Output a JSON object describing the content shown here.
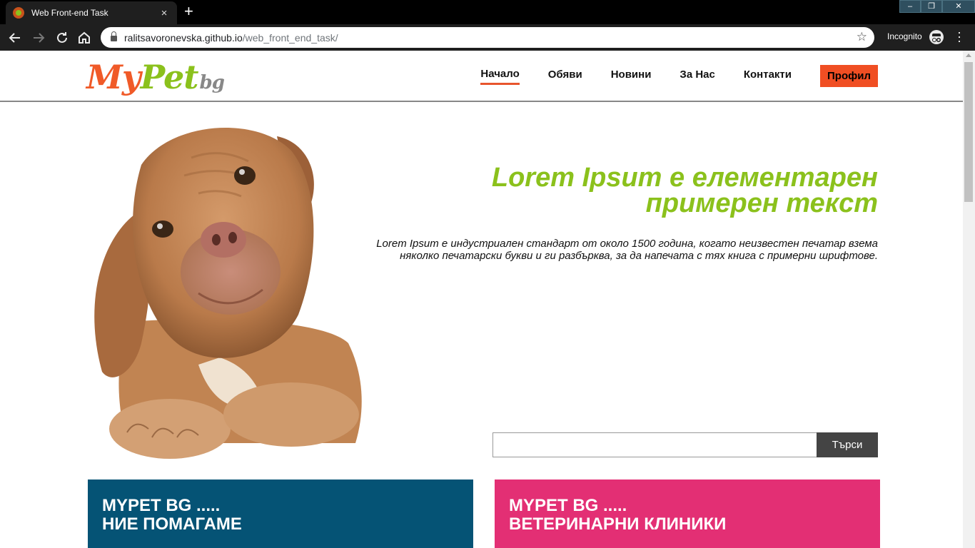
{
  "browser": {
    "tab_title": "Web Front-end Task",
    "tab_close": "×",
    "new_tab": "+",
    "url_host": "ralitsavoronevska.github.io",
    "url_path": "/web_front_end_task/",
    "incognito_label": "Incognito",
    "window_controls": [
      "–",
      "❐",
      "✕"
    ]
  },
  "site": {
    "logo": {
      "my": "My",
      "pet": "Pet",
      "bg": "bg"
    },
    "nav": [
      "Начало",
      "Обяви",
      "Новини",
      "За Нас",
      "Контакти"
    ],
    "profile": "Профил",
    "hero": {
      "title_line1": "Lorem Ipsum е елементарен",
      "title_line2": "примерен текст",
      "body": "Lorem Ipsum е индустриален стандарт от около 1500 година, когато неизвестен печатар взема няколко печатарски букви и ги разбърква, за да напечата с тях книга с примерни шрифтове."
    },
    "search": {
      "placeholder": "",
      "button": "Търси"
    },
    "cards": [
      {
        "line1": "MYPET BG .....",
        "line2": "НИЕ ПОМАГАМЕ"
      },
      {
        "line1": "MYPET BG .....",
        "line2": "ВЕТЕРИНАРНИ КЛИНИКИ"
      }
    ]
  },
  "colors": {
    "accent_orange": "#f04e23",
    "accent_green": "#8bc11c",
    "card_blue": "#055375",
    "card_pink": "#e32f74"
  },
  "icons": [
    "back-arrow-icon",
    "forward-arrow-icon",
    "reload-icon",
    "home-icon",
    "lock-icon",
    "star-icon",
    "incognito-icon",
    "menu-icon"
  ]
}
